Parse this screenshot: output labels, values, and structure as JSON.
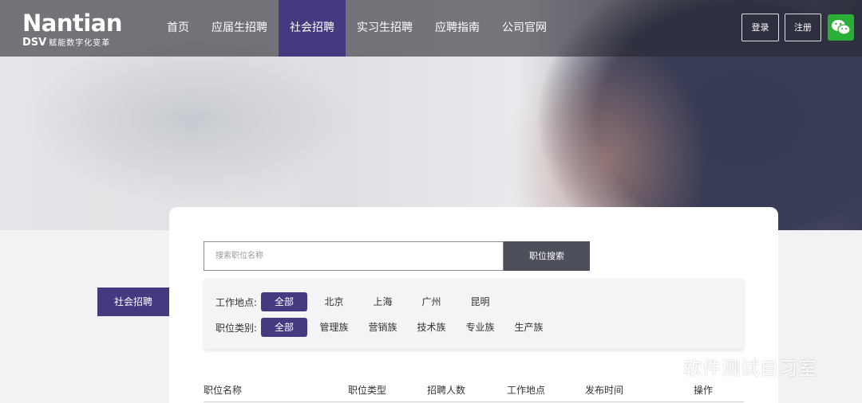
{
  "brand": {
    "name": "Nantian",
    "sub": "DSV",
    "slogan": "赋能数字化变革"
  },
  "nav": {
    "items": [
      {
        "label": "首页"
      },
      {
        "label": "应届生招聘"
      },
      {
        "label": "社会招聘"
      },
      {
        "label": "实习生招聘"
      },
      {
        "label": "应聘指南"
      },
      {
        "label": "公司官网"
      }
    ],
    "active_index": 2,
    "login_label": "登录",
    "register_label": "注册"
  },
  "search": {
    "placeholder": "搜索职位名称",
    "value": "",
    "button_label": "职位搜索"
  },
  "side_tab": {
    "label": "社会招聘"
  },
  "filters": {
    "location": {
      "label": "工作地点:",
      "options": [
        "全部",
        "北京",
        "上海",
        "广州",
        "昆明"
      ],
      "selected": "全部"
    },
    "category": {
      "label": "职位类别:",
      "options": [
        "全部",
        "管理族",
        "营销族",
        "技术族",
        "专业族",
        "生产族"
      ],
      "selected": "全部"
    }
  },
  "table": {
    "headers": [
      "职位名称",
      "职位类型",
      "招聘人数",
      "工作地点",
      "发布时间",
      "操作"
    ]
  },
  "watermark": {
    "text": "软件测试自习室"
  },
  "colors": {
    "accent": "#433a7f",
    "search_button": "#4d4f5b",
    "wechat": "#2aae35"
  }
}
